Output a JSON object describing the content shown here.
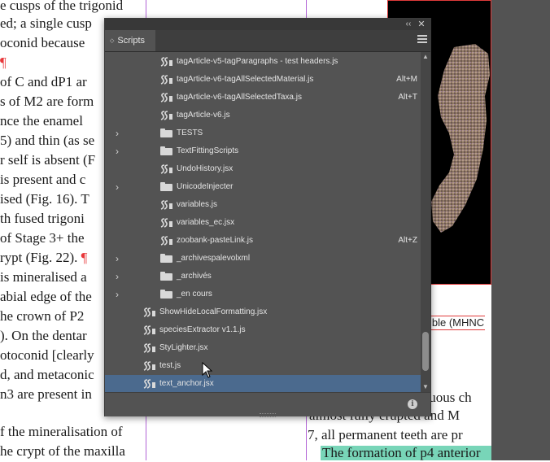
{
  "document": {
    "left_lines": [
      "e cusps of the trigonid",
      "ed; a single cusp",
      "oconid because",
      "¶",
      "of C and dP1 ar",
      "s of M2 are form",
      "nce the enamel",
      "5) and thin (as se",
      "r self is absent (F",
      "is present and c",
      "ised (Fig. 16). T",
      "th fused trigoni",
      "of Stage 3+ the",
      "rypt (Fig. 22). ¶",
      "is mineralised a",
      "abial edge of the",
      "he crown of P2",
      "). On the dentar",
      "otoconid [clearly",
      "d, and metaconic",
      "n3 are present in",
      "",
      "f the mineralisation of",
      "he crypt of the maxilla"
    ],
    "right_lines": [
      "ible (MHNC",
      "iduous ch",
      "almost fully erupted and M",
      "7, all permanent teeth are pr",
      "The formation of p4 anterior"
    ]
  },
  "panel": {
    "tab_label": "Scripts",
    "collapse_glyph": "‹‹",
    "close_glyph": "✕",
    "info_glyph": "i",
    "items": [
      {
        "type": "script",
        "label": "tagArticle-v5-tagParagraphs - test headers.js",
        "shortcut": "",
        "indent": 1
      },
      {
        "type": "script",
        "label": "tagArticle-v6-tagAllSelectedMaterial.js",
        "shortcut": "Alt+M",
        "indent": 1
      },
      {
        "type": "script",
        "label": "tagArticle-v6-tagAllSelectedTaxa.js",
        "shortcut": "Alt+T",
        "indent": 1
      },
      {
        "type": "script",
        "label": "tagArticle-v6.js",
        "shortcut": "",
        "indent": 1
      },
      {
        "type": "folder",
        "label": "TESTS",
        "shortcut": "",
        "indent": 1
      },
      {
        "type": "folder",
        "label": "TextFittingScripts",
        "shortcut": "",
        "indent": 1
      },
      {
        "type": "script",
        "label": "UndoHistory.jsx",
        "shortcut": "",
        "indent": 1
      },
      {
        "type": "folder",
        "label": "UnicodeInjecter",
        "shortcut": "",
        "indent": 1
      },
      {
        "type": "script",
        "label": "variables.js",
        "shortcut": "",
        "indent": 1
      },
      {
        "type": "script",
        "label": "variables_ec.jsx",
        "shortcut": "",
        "indent": 1
      },
      {
        "type": "script",
        "label": "zoobank-pasteLink.js",
        "shortcut": "Alt+Z",
        "indent": 1
      },
      {
        "type": "folder",
        "label": "_archivespalevolxml",
        "shortcut": "",
        "indent": 1
      },
      {
        "type": "folder",
        "label": "_archivés",
        "shortcut": "",
        "indent": 1
      },
      {
        "type": "folder",
        "label": "_en cours",
        "shortcut": "",
        "indent": 1
      },
      {
        "type": "script",
        "label": "ShowHideLocalFormatting.jsx",
        "shortcut": "",
        "indent": 0
      },
      {
        "type": "script",
        "label": "speciesExtractor v1.1.js",
        "shortcut": "",
        "indent": 0
      },
      {
        "type": "script",
        "label": "StyLighter.jsx",
        "shortcut": "",
        "indent": 0
      },
      {
        "type": "script",
        "label": "test.js",
        "shortcut": "",
        "indent": 0
      },
      {
        "type": "script",
        "label": "text_anchor.jsx",
        "shortcut": "",
        "indent": 0,
        "selected": true
      }
    ]
  },
  "colors": {
    "panel_bg": "#535353",
    "selected_row": "#4b6a8e",
    "pilcrow": "#e8373a",
    "column_rule": "#b264d6",
    "highlight": "#78d5b8"
  },
  "icons": {
    "script": "script-icon",
    "folder": "folder-icon",
    "disclosure": "chevron-right-icon",
    "info": "info-icon",
    "menu": "panel-menu-icon",
    "cursor": "mouse-pointer-icon"
  }
}
